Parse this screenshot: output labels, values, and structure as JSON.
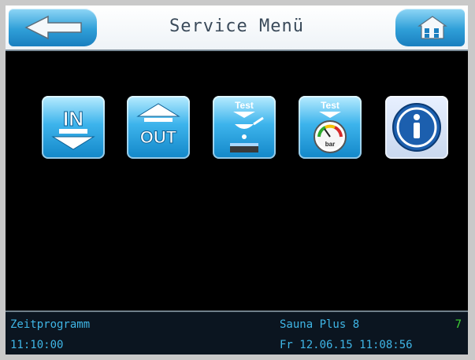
{
  "header": {
    "title": "Service Menü",
    "back_icon": "arrow-left-icon",
    "home_icon": "house-icon"
  },
  "tiles": [
    {
      "name": "in-button",
      "label": "IN",
      "icon": "input-arrow-down-icon"
    },
    {
      "name": "out-button",
      "label": "OUT",
      "icon": "output-arrow-up-icon"
    },
    {
      "name": "test-dosing-button",
      "label": "Test",
      "icon": "test-water-drop-icon"
    },
    {
      "name": "test-pressure-button",
      "label": "Test",
      "label2": "bar",
      "icon": "test-pressure-gauge-icon"
    },
    {
      "name": "info-button",
      "icon": "info-icon"
    }
  ],
  "status": {
    "program": "Zeitprogramm",
    "time": "11:10:00",
    "device": "Sauna Plus 8",
    "number": "7",
    "datetime": "Fr 12.06.15 11:08:56"
  },
  "colors": {
    "accent_blue": "#2f9fd8",
    "status_text": "#3fb6e6",
    "status_number": "#3fd234",
    "background": "#000000"
  }
}
